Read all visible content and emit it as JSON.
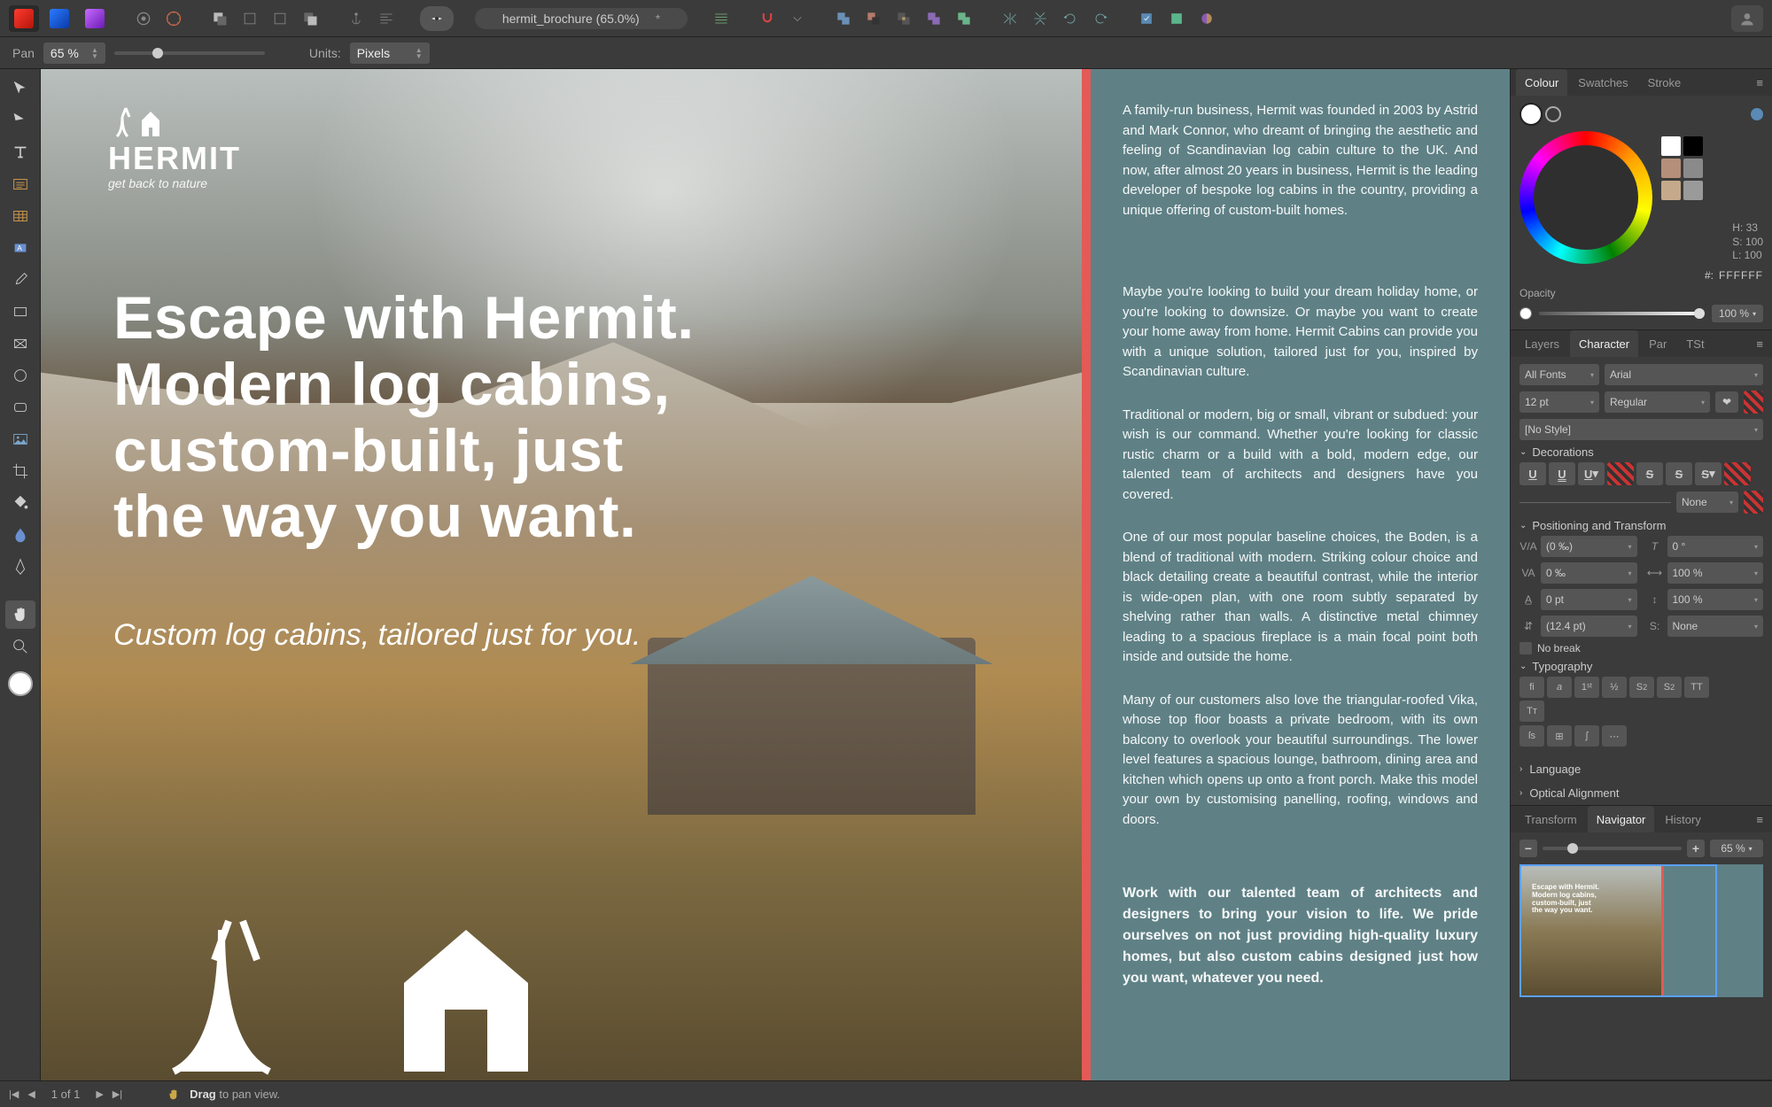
{
  "document": {
    "title": "hermit_brochure (65.0%)",
    "modified": "*"
  },
  "context_bar": {
    "tool_label": "Pan",
    "zoom": "65 %",
    "units_label": "Units:",
    "units_value": "Pixels"
  },
  "canvas": {
    "spread": {
      "logo_word": "HERMIT",
      "logo_tagline": "get back to nature",
      "headline_l1": "Escape with Hermit.",
      "headline_l2": "Modern log cabins,",
      "headline_l3": "custom-built, just",
      "headline_l4": "the way you want.",
      "subhead": "Custom log cabins, tailored just for you.",
      "intro": "A family-run business, Hermit was founded in 2003 by Astrid and Mark Connor, who dreamt of bringing the aesthetic and feeling of Scandinavian log cabin culture to the UK. And now, after almost 20 years in business, Hermit is the leading developer of bespoke log cabins in the country, providing a unique offering of custom-built homes.",
      "para1": "Maybe you're looking to build your dream holiday home, or you're looking to downsize. Or maybe you want to create your home away from home. Hermit Cabins can provide you with a unique solution, tailored just for you, inspired by Scandinavian culture.",
      "para2": "Traditional or modern, big or small, vibrant or subdued: your wish is our command. Whether you're looking for classic rustic charm or a build with a bold, modern edge, our talented team of architects and designers have you covered.",
      "para3": "One of our most popular baseline choices, the Boden, is a blend of traditional with modern. Striking colour choice and black detailing create a beautiful contrast, while the interior is wide-open plan, with one room subtly separated by shelving rather than walls. A distinctive metal chimney leading to a spacious fireplace is a main focal point both inside and outside the home.",
      "para4": "Many of our customers also love the triangular-roofed Vika, whose top floor boasts a private bedroom, with its own balcony to overlook your beautiful surroundings. The lower level features a spacious lounge, bathroom, dining area and kitchen which opens up onto a front porch. Make this model your own by customising panelling, roofing, windows and doors.",
      "cta": "Work with our talented team of architects and designers to bring your vision to life. We pride ourselves on not just providing high-quality luxury homes, but also custom cabins designed just how you want, whatever you need."
    }
  },
  "studio": {
    "colour_tabs": {
      "colour": "Colour",
      "swatches": "Swatches",
      "stroke": "Stroke"
    },
    "colour": {
      "h": "H: 33",
      "s": "S: 100",
      "l": "L: 100",
      "hex_prefix": "#:",
      "hex": "FFFFFF",
      "opacity_label": "Opacity",
      "opacity_value": "100 %"
    },
    "char_tabs": {
      "layers": "Layers",
      "character": "Character",
      "par": "Par",
      "tst": "TSt"
    },
    "char": {
      "font_collection": "All Fonts",
      "font_family": "Arial",
      "font_size": "12 pt",
      "font_weight": "Regular",
      "style": "[No Style]",
      "dec_header": "Decorations",
      "dec_none": "None",
      "pos_header": "Positioning and Transform",
      "kerning": "(0 ‰)",
      "tracking": "0 ‰",
      "leading": "0 pt",
      "leading_override": "(12.4 pt)",
      "shear": "0 °",
      "hscale": "100 %",
      "vscale": "100 %",
      "baseline_grid": "None",
      "no_break": "No break",
      "typo_header": "Typography",
      "lang_header": "Language",
      "optalign_header": "Optical Alignment"
    },
    "nav_tabs": {
      "transform": "Transform",
      "navigator": "Navigator",
      "history": "History"
    },
    "nav": {
      "zoom": "65 %"
    }
  },
  "status": {
    "page_of": "1 of 1",
    "hint_strong": "Drag",
    "hint_rest": " to pan view."
  }
}
